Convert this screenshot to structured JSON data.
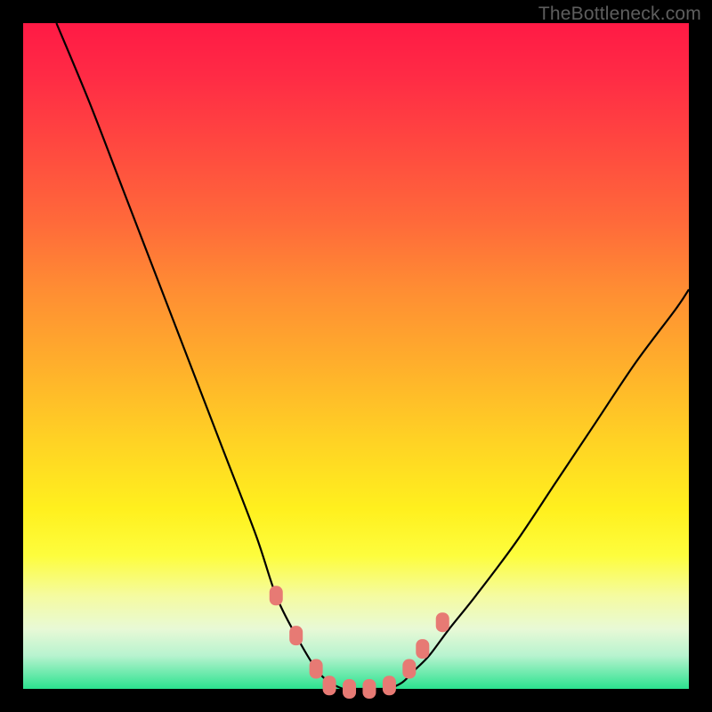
{
  "watermark": "TheBottleneck.com",
  "chart_data": {
    "type": "line",
    "title": "",
    "xlabel": "",
    "ylabel": "",
    "xlim": [
      0,
      100
    ],
    "ylim": [
      0,
      100
    ],
    "grid": false,
    "legend": false,
    "series": [
      {
        "name": "left-curve",
        "x": [
          5,
          10,
          15,
          20,
          25,
          30,
          35,
          38,
          41,
          44,
          46,
          48
        ],
        "values": [
          100,
          88,
          75,
          62,
          49,
          36,
          23,
          14,
          8,
          3,
          1,
          0
        ]
      },
      {
        "name": "right-curve",
        "x": [
          55,
          57,
          59,
          61,
          64,
          68,
          74,
          80,
          86,
          92,
          98,
          100
        ],
        "values": [
          0,
          1,
          3,
          5,
          9,
          14,
          22,
          31,
          40,
          49,
          57,
          60
        ]
      },
      {
        "name": "bottom-flat",
        "x": [
          48,
          50,
          52,
          55
        ],
        "values": [
          0,
          0,
          0,
          0
        ]
      }
    ],
    "markers": [
      {
        "name": "left-upper-marker",
        "x": 38,
        "y": 14
      },
      {
        "name": "left-mid-marker",
        "x": 41,
        "y": 8
      },
      {
        "name": "left-lower-marker",
        "x": 44,
        "y": 3
      },
      {
        "name": "bottom-marker-1",
        "x": 46,
        "y": 0.5
      },
      {
        "name": "bottom-marker-2",
        "x": 49,
        "y": 0
      },
      {
        "name": "bottom-marker-3",
        "x": 52,
        "y": 0
      },
      {
        "name": "bottom-marker-4",
        "x": 55,
        "y": 0.5
      },
      {
        "name": "right-lower-marker",
        "x": 58,
        "y": 3
      },
      {
        "name": "right-mid-marker",
        "x": 60,
        "y": 6
      },
      {
        "name": "right-upper-marker",
        "x": 63,
        "y": 10
      }
    ],
    "marker_style": {
      "color": "#e77a74",
      "rx": 7,
      "w": 15,
      "h": 22
    },
    "curve_style": {
      "stroke": "#000000",
      "width": 2.2
    }
  }
}
